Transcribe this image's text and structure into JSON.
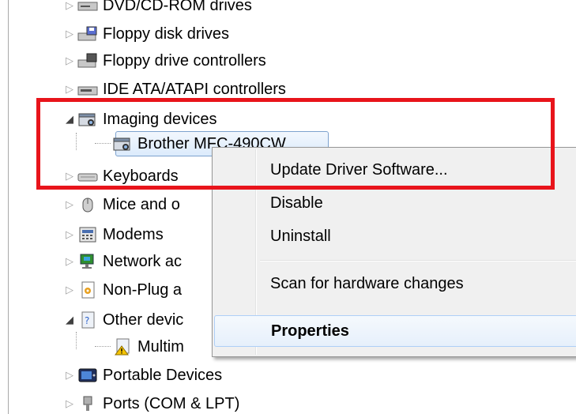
{
  "tree": {
    "items": [
      {
        "label": "DVD/CD-ROM drives",
        "expander": "closed",
        "icon": "dvd-drive-icon"
      },
      {
        "label": "Floppy disk drives",
        "expander": "closed",
        "icon": "floppy-disk-icon"
      },
      {
        "label": "Floppy drive controllers",
        "expander": "closed",
        "icon": "floppy-controller-icon"
      },
      {
        "label": "IDE ATA/ATAPI controllers",
        "expander": "closed",
        "icon": "ide-controller-icon"
      },
      {
        "label": "Imaging devices",
        "expander": "open",
        "icon": "camera-icon"
      },
      {
        "label": "Brother MFC-490CW",
        "expander": "none",
        "icon": "scanner-camera-icon"
      },
      {
        "label": "Keyboards",
        "expander": "closed",
        "icon": "keyboard-icon"
      },
      {
        "label": "Mice and o",
        "expander": "closed",
        "icon": "mouse-icon"
      },
      {
        "label": "Modems",
        "expander": "closed",
        "icon": "modem-icon"
      },
      {
        "label": "Network ac",
        "expander": "closed",
        "icon": "network-adapter-icon"
      },
      {
        "label": "Non-Plug a",
        "expander": "closed",
        "icon": "non-plug-icon"
      },
      {
        "label": "Other devic",
        "expander": "open",
        "icon": "unknown-device-icon"
      },
      {
        "label": "Multim",
        "expander": "none",
        "icon": "warning-device-icon"
      },
      {
        "label": "Portable Devices",
        "expander": "closed",
        "icon": "portable-device-icon"
      },
      {
        "label": "Ports (COM & LPT)",
        "expander": "closed",
        "icon": "port-icon"
      }
    ]
  },
  "context_menu": {
    "items": [
      {
        "label": "Update Driver Software...",
        "bold": false
      },
      {
        "label": "Disable",
        "bold": false
      },
      {
        "label": "Uninstall",
        "bold": false
      },
      {
        "label": "Scan for hardware changes",
        "bold": false
      },
      {
        "label": "Properties",
        "bold": true
      }
    ]
  },
  "colors": {
    "highlight_box": "#e8141b",
    "selection_border": "#7da2ce",
    "menu_background": "#f0f0f0"
  }
}
